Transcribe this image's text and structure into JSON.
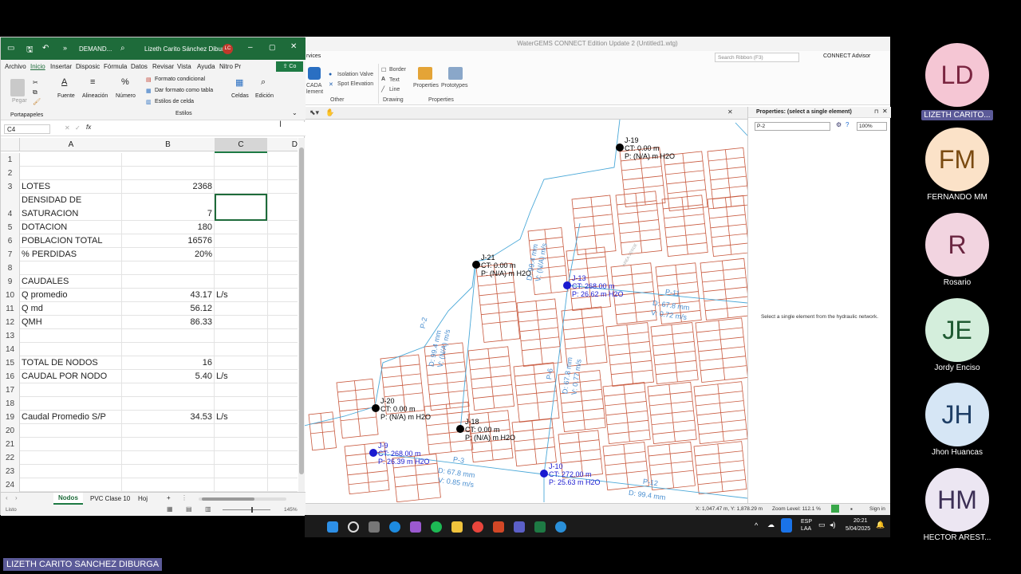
{
  "watergems": {
    "title": "WaterGEMS CONNECT Edition Update 2 (Untitled1.wtg)",
    "tab_partial": "rvices",
    "search_placeholder": "Search Ribbon (F3)",
    "advisor": "CONNECT Advisor",
    "ribbon": {
      "scada": "CADA",
      "element": "lement",
      "isolation": "Isolation Valve",
      "spot": "Spot Elevation",
      "other": "Other",
      "border": "Border",
      "text": "Text",
      "line": "Line",
      "drawing": "Drawing",
      "properties": "Properties",
      "prototypes": "Prototypes",
      "properties_group": "Properties"
    },
    "props_title": "Properties:  (select a single element)",
    "props_select": "P-2",
    "props_zoom": "100%",
    "props_msg": "Select a single element from the hydraulic network.",
    "status": {
      "coords": "X: 1,047.47 m, Y: 1,878.29 m",
      "zoom": "Zoom Level: 112.1 %",
      "signin": "Sign in"
    },
    "nodes": [
      {
        "id": "J-19",
        "l1": "CT: 0.00 m",
        "l2": "P: (N/A) m H2O",
        "color": "#000"
      },
      {
        "id": "J-21",
        "l1": "CT: 0.00 m",
        "l2": "P: (N/A) m H2O",
        "color": "#000"
      },
      {
        "id": "J-13",
        "l1": "CT: 268.00 m",
        "l2": "P: 26.62 m H2O",
        "color": "#1a1ad0"
      },
      {
        "id": "J-20",
        "l1": "CT: 0.00 m",
        "l2": "P: (N/A) m H2O",
        "color": "#000"
      },
      {
        "id": "J-18",
        "l1": "CT: 0.00 m",
        "l2": "P: (N/A) m H2O",
        "color": "#000"
      },
      {
        "id": "J-9",
        "l1": "CT: 268.00 m",
        "l2": "P: 26.39 m H2O",
        "color": "#1a1ad0"
      },
      {
        "id": "J-10",
        "l1": "CT: 272.00 m",
        "l2": "P: 25.63 m H2O",
        "color": "#1a1ad0"
      }
    ],
    "pipes": {
      "p2": "P-2",
      "p2d": "D: 99.4 mm",
      "p2v": "V: (N/A) m/s",
      "p4d": "D: 99.4 mm",
      "p4v": "V: (N/A) m/s",
      "p11": "P-11",
      "p11d": "D: 67.8 mm",
      "p11v": "V: 0.72 m/s",
      "p6": "P-6",
      "p6d": "D: 67.8 mm",
      "p6v": "V: 0.77 m/s",
      "p3": "P-3",
      "p3d": "D: 67.8 mm",
      "p3v": "V: 0.85 m/s",
      "p12": "P-12",
      "p12d": "D: 99.4 mm",
      "area": "AREA VERDE"
    }
  },
  "excel": {
    "title": "DEMAND...",
    "user": "Lizeth Carito Sánchez Diburga",
    "user_initials": "LC",
    "menu": [
      "Archivo",
      "Inicio",
      "Insertar",
      "Disposic",
      "Fórmula",
      "Datos",
      "Revisar",
      "Vista",
      "Ayuda",
      "Nitro Pr"
    ],
    "ribbon": {
      "pegar": "Pegar",
      "portapapeles": "Portapapeles",
      "fuente": "Fuente",
      "alineacion": "Alineación",
      "numero": "Número",
      "formato_cond": "Formato condicional",
      "formato_tabla": "Dar formato como tabla",
      "estilos_celda": "Estilos de celda",
      "estilos": "Estilos",
      "celdas": "Celdas",
      "edicion": "Edición"
    },
    "namebox": "C4",
    "cols": [
      "A",
      "B",
      "C",
      "D"
    ],
    "rows": [
      {
        "n": "1",
        "a": "",
        "b": "",
        "c": ""
      },
      {
        "n": "2",
        "a": "",
        "b": "",
        "c": ""
      },
      {
        "n": "3",
        "a": "LOTES",
        "b": "2368",
        "c": ""
      },
      {
        "n": "4",
        "a": "DENSIDAD DE",
        "a2": "SATURACION",
        "b": "7",
        "c": ""
      },
      {
        "n": "5",
        "a": "DOTACION",
        "b": "180",
        "c": ""
      },
      {
        "n": "6",
        "a": "POBLACION TOTAL",
        "b": "16576",
        "c": ""
      },
      {
        "n": "7",
        "a": "% PERDIDAS",
        "b": "20%",
        "c": ""
      },
      {
        "n": "8",
        "a": "",
        "b": "",
        "c": ""
      },
      {
        "n": "9",
        "a": "CAUDALES",
        "b": "",
        "c": ""
      },
      {
        "n": "10",
        "a": "Q promedio",
        "b": "43.17",
        "c": "L/s"
      },
      {
        "n": "11",
        "a": "Q md",
        "b": "56.12",
        "c": ""
      },
      {
        "n": "12",
        "a": "QMH",
        "b": "86.33",
        "c": ""
      },
      {
        "n": "13",
        "a": "",
        "b": "",
        "c": ""
      },
      {
        "n": "14",
        "a": "",
        "b": "",
        "c": ""
      },
      {
        "n": "15",
        "a": "TOTAL DE NODOS",
        "b": "16",
        "c": ""
      },
      {
        "n": "16",
        "a": "CAUDAL POR NODO",
        "b": "5.40",
        "c": "L/s"
      },
      {
        "n": "17",
        "a": "",
        "b": "",
        "c": ""
      },
      {
        "n": "18",
        "a": "",
        "b": "",
        "c": ""
      },
      {
        "n": "19",
        "a": "Caudal Promedio S/P",
        "b": "34.53",
        "c": "L/s"
      },
      {
        "n": "20",
        "a": "",
        "b": "",
        "c": ""
      },
      {
        "n": "21",
        "a": "",
        "b": "",
        "c": ""
      },
      {
        "n": "22",
        "a": "",
        "b": "",
        "c": ""
      },
      {
        "n": "23",
        "a": "",
        "b": "",
        "c": ""
      },
      {
        "n": "24",
        "a": "",
        "b": "",
        "c": ""
      }
    ],
    "tabs": [
      "Nodos",
      "PVC Clase 10",
      "Hoj"
    ],
    "status": "Listo",
    "zoom": "145%"
  },
  "taskbar": {
    "lang": "ESP",
    "lang2": "LAA",
    "time": "20:21",
    "date": "5/04/2025"
  },
  "participants": [
    {
      "initials": "LD",
      "name": "LIZETH CARITO...",
      "bg": "#f5c6d4",
      "fg": "#7a2540"
    },
    {
      "initials": "FM",
      "name": "FERNANDO MM",
      "bg": "#fbe2c8",
      "fg": "#7a4a10"
    },
    {
      "initials": "R",
      "name": "Rosario",
      "bg": "#f2d4e0",
      "fg": "#6a2540"
    },
    {
      "initials": "JE",
      "name": "Jordy Enciso",
      "bg": "#d4eedc",
      "fg": "#1f5a32"
    },
    {
      "initials": "JH",
      "name": "Jhon Huancas",
      "bg": "#d6e6f5",
      "fg": "#1f3f66"
    },
    {
      "initials": "HM",
      "name": "HECTOR AREST...",
      "bg": "#ece6f2",
      "fg": "#3c2f55"
    }
  ],
  "speaker": "LIZETH CARITO SANCHEZ DIBURGA"
}
